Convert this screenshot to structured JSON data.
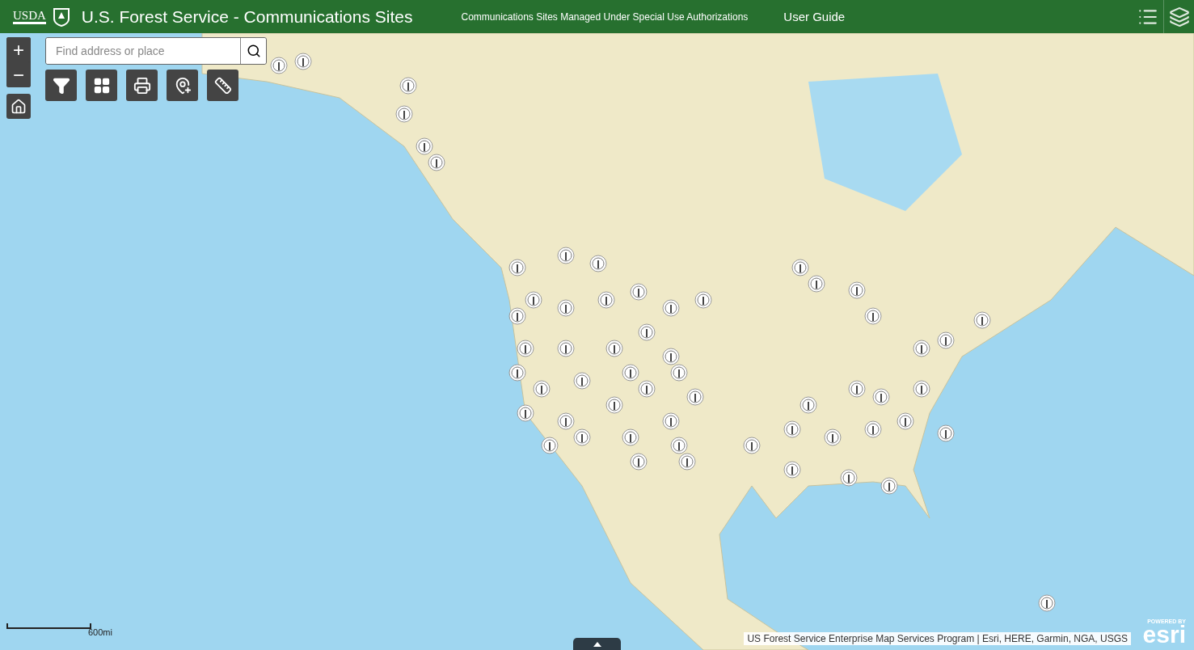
{
  "header": {
    "logo_text": "USDA",
    "title": "U.S. Forest Service - Communications Sites",
    "links": [
      "Communications Sites Managed Under Special Use Authorizations",
      "User Guide"
    ]
  },
  "map": {
    "zoom_buttons": [
      "+",
      "−"
    ],
    "search": {
      "placeholder": "Find address or place"
    },
    "scale": "600mi",
    "attribution": "US Forest Service Enterprise Map Services Program | Esri, HERE, Garmin, NGA, USGS",
    "esri": {
      "tagline": "POWERED BY",
      "name": "esri"
    }
  }
}
